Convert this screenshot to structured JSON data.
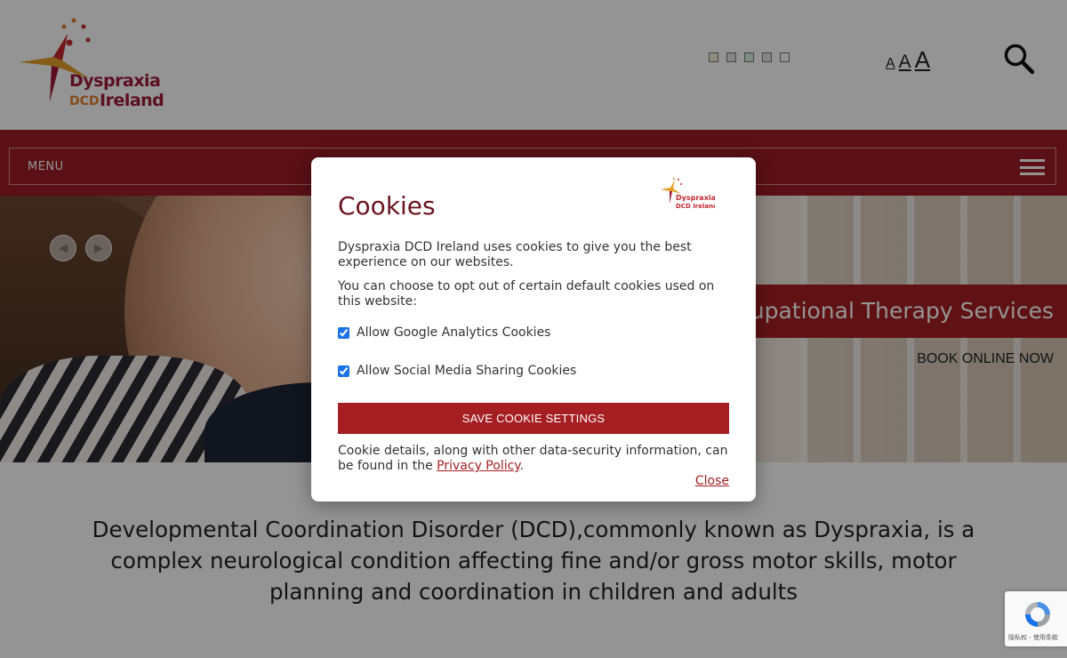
{
  "header": {
    "logo_line1": "Dyspraxia",
    "logo_dcd": "DCD",
    "logo_ireland": "Ireland",
    "color_swatches": [
      "#f3f3d8",
      "#e6e6e6",
      "#d9f0e4",
      "#e6e6e6",
      "#ffffff"
    ],
    "text_size": {
      "small": "A",
      "medium": "A",
      "large": "A"
    },
    "search_icon": "search-icon"
  },
  "nav": {
    "menu_label": "MENU",
    "menu_icon": "hamburger-icon"
  },
  "hero": {
    "banner_title": "upational Therapy Services",
    "banner_cta": "BOOK ONLINE NOW",
    "prev_icon": "chevron-left-icon",
    "next_icon": "chevron-right-icon"
  },
  "intro": {
    "text": "Developmental Coordination Disorder (DCD),commonly known as Dyspraxia, is a complex neurological condition affecting fine and/or gross motor skills, motor planning and coordination in children and adults"
  },
  "cookie_modal": {
    "title": "Cookies",
    "logo_line1": "Dyspraxia",
    "logo_line2": "DCD Ireland",
    "intro": "Dyspraxia DCD Ireland uses cookies to give you the best experience on our websites.",
    "opt_out": "You can choose to opt out of certain default cookies used on this website:",
    "options": [
      {
        "label": "Allow Google Analytics Cookies",
        "checked": true
      },
      {
        "label": "Allow Social Media Sharing Cookies",
        "checked": true
      }
    ],
    "save_label": "SAVE COOKIE SETTINGS",
    "details_prefix": "Cookie details, along with other data-security information, can be found in the ",
    "privacy_link": "Privacy Policy",
    "details_suffix": ".",
    "close_label": "Close"
  },
  "recaptcha": {
    "footer_text": "隐私权 - 使用条款"
  },
  "colors": {
    "brand_red": "#a51e22",
    "nav_red": "#9b1c26",
    "title_maroon": "#6b1420"
  }
}
